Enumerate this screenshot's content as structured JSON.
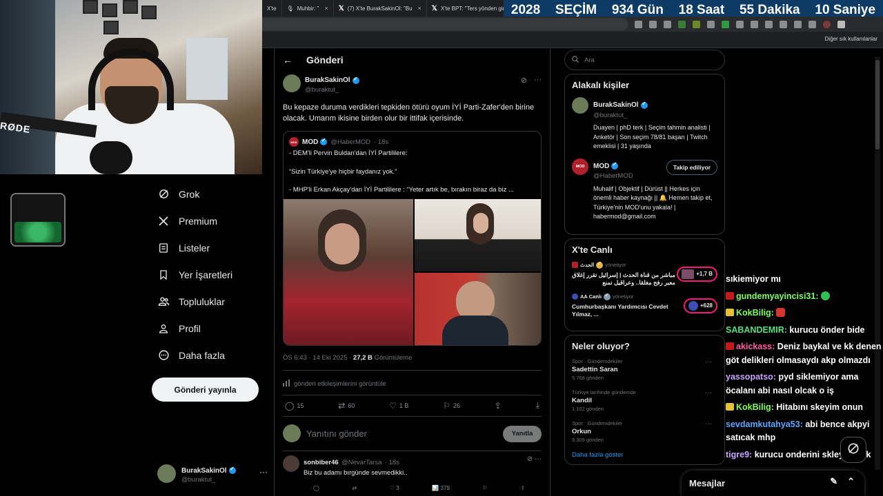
{
  "browser": {
    "tabs": [
      {
        "icon": "",
        "label": "X'te",
        "close": "×"
      },
      {
        "icon": "🎙",
        "label": "Muhbir: \"",
        "close": "×"
      },
      {
        "icon": "𝕏",
        "label": "(7) X'te BurakSakinOl: \"Bu",
        "close": "×"
      },
      {
        "icon": "𝕏",
        "label": "X'te BPT: \"Ters yönden gir",
        "close": "×"
      }
    ],
    "bookmarks_label": "Diğer sık kullanılanlar"
  },
  "countdown": {
    "year": "2028",
    "label": "SEÇİM",
    "days": "934 Gün",
    "hours": "18 Saat",
    "minutes": "55 Dakika",
    "seconds": "10 Saniye"
  },
  "webcam": {
    "mic_brand": "RØDE"
  },
  "nav": {
    "items": [
      {
        "label": "Grok",
        "icon": "grok-icon"
      },
      {
        "label": "Premium",
        "icon": "x-logo-icon"
      },
      {
        "label": "Listeler",
        "icon": "list-icon"
      },
      {
        "label": "Yer İşaretleri",
        "icon": "bookmark-icon"
      },
      {
        "label": "Topluluklar",
        "icon": "communities-icon"
      },
      {
        "label": "Profil",
        "icon": "profile-icon"
      },
      {
        "label": "Daha fazla",
        "icon": "more-circle-icon"
      }
    ],
    "post_button": "Gönderi yayınla",
    "account": {
      "name": "BurakSakinOl",
      "handle": "@buraktut_"
    }
  },
  "main": {
    "title": "Gönderi",
    "tweet": {
      "name": "BurakSakinOl",
      "handle": "@buraktut_",
      "text": "Bu kepaze duruma verdikleri tepkiden ötürü oyum İYİ Parti-Zafer'den birine olacak. Umarım ikisine birden olur bir ittifak içerisinde.",
      "quote": {
        "avatar": "MOD",
        "name": "MOD",
        "handle": "@HaberMOD",
        "time": "· 18s",
        "lines": [
          "- DEM'li Pervin Buldan'dan İYİ Partililere:",
          "“Sizin Türkiye'ye hiçbir faydanız yok.”",
          "- MHP'li Erkan Akçay'dan İYİ Partililere : “Yeter artık be, bırakın biraz da biz ..."
        ]
      },
      "time": "ÖS 6:43 · 14 Eki 2025 ·",
      "views": "27,2 B",
      "views_label": "Görüntüleme",
      "engagement_link": "gönderi etkileşimlerini görüntüle",
      "stats": {
        "replies": "15",
        "reposts": "60",
        "likes": "1 B",
        "bookmarks": "26"
      }
    },
    "reply_placeholder": "Yanıtını gönder",
    "reply_button": "Yanıtla",
    "reply": {
      "name": "sonbiber46",
      "handle": "@NevarTarsa",
      "time": "· 18s",
      "text": "Biz bu adamı bırgünde sevmedikki..",
      "stats": {
        "replies": "",
        "reposts": "",
        "likes": "3",
        "views": "379"
      }
    }
  },
  "right": {
    "search_placeholder": "Ara",
    "relevant": {
      "title": "Alakalı kişiler",
      "people": [
        {
          "avatar": "",
          "name": "BurakSakinOl",
          "handle": "@buraktut_",
          "bio": "Duayen | phD terk | Seçim tahmin analisti | Anketör | Son seçim 78/81 başarı | Twitch emeklisi | 31 yaşında",
          "button": ""
        },
        {
          "avatar": "MOD",
          "name": "MOD",
          "handle": "@HaberMOD",
          "bio": "Muhalif | Objektif | Dürüst || Herkes için önemli haber kaynağı || 🔔 Hemen takip et, Türkiye'nin MOD'unu yakala! | habermod@gmail.com",
          "button": "Takip ediliyor"
        }
      ]
    },
    "live": {
      "title": "X'te Canlı",
      "items": [
        {
          "host": "الحدث",
          "by": "yönetiyor",
          "text": "مباشر من قناة الحدث | إسرائيل تقرر إغلاق معبر رفح مغلقا.. وعراقيل تمنع",
          "count": "+1,7 B"
        },
        {
          "host": "AA Canlı",
          "by": "yönetiyor",
          "text": "Cumhurbaşkanı Yardımcısı Cevdet Yılmaz, ...",
          "count": "+628"
        }
      ]
    },
    "trends": {
      "title": "Neler oluyor?",
      "items": [
        {
          "category": "Spor · Gündemdekiler",
          "topic": "Sadettin Saran",
          "count": "5.768 gönderi"
        },
        {
          "category": "Türkiye tarihinde gündemde",
          "topic": "Kandil",
          "count": "1.102 gönderi"
        },
        {
          "category": "Spor · Gündemdekiler",
          "topic": "Orkun",
          "count": "9.309 gönderi"
        }
      ],
      "show_more": "Daha fazla göster"
    }
  },
  "chat": [
    {
      "user": "",
      "color": "#ffffff",
      "badge": "",
      "text": "sıkiemiyor mı",
      "emote": ""
    },
    {
      "user": "gundemyayincisi31:",
      "color": "#7cff5c",
      "badge": "red",
      "text": "",
      "emote": "green"
    },
    {
      "user": "KokBilig:",
      "color": "#7cff5c",
      "badge": "yellow",
      "text": "",
      "emote": "red"
    },
    {
      "user": "SABANDEMIR:",
      "color": "#57e07d",
      "badge": "",
      "text": "kurucu önder bide",
      "emote": ""
    },
    {
      "user": "akickass:",
      "color": "#ff5f9e",
      "badge": "red",
      "text": "Deniz baykal ve kk denen göt delikleri olmasaydı akp olmazdı",
      "emote": ""
    },
    {
      "user": "yassopatso:",
      "color": "#c7a2ff",
      "badge": "",
      "text": "pyd siklemiyor ama öcalanı abi nasıl olcak o iş",
      "emote": ""
    },
    {
      "user": "KokBilig:",
      "color": "#7cff5c",
      "badge": "yellow",
      "text": "Hitabını skeyim onun",
      "emote": ""
    },
    {
      "user": "sevdamkutahya53:",
      "color": "#5aa7ff",
      "badge": "",
      "text": "abi bence akpyi satıcak mhp",
      "emote": ""
    },
    {
      "user": "tigre9:",
      "color": "#c7a2ff",
      "badge": "",
      "text": "kurucu onderini skleyen yok",
      "emote": ""
    }
  ],
  "messages_label": "Mesajlar"
}
